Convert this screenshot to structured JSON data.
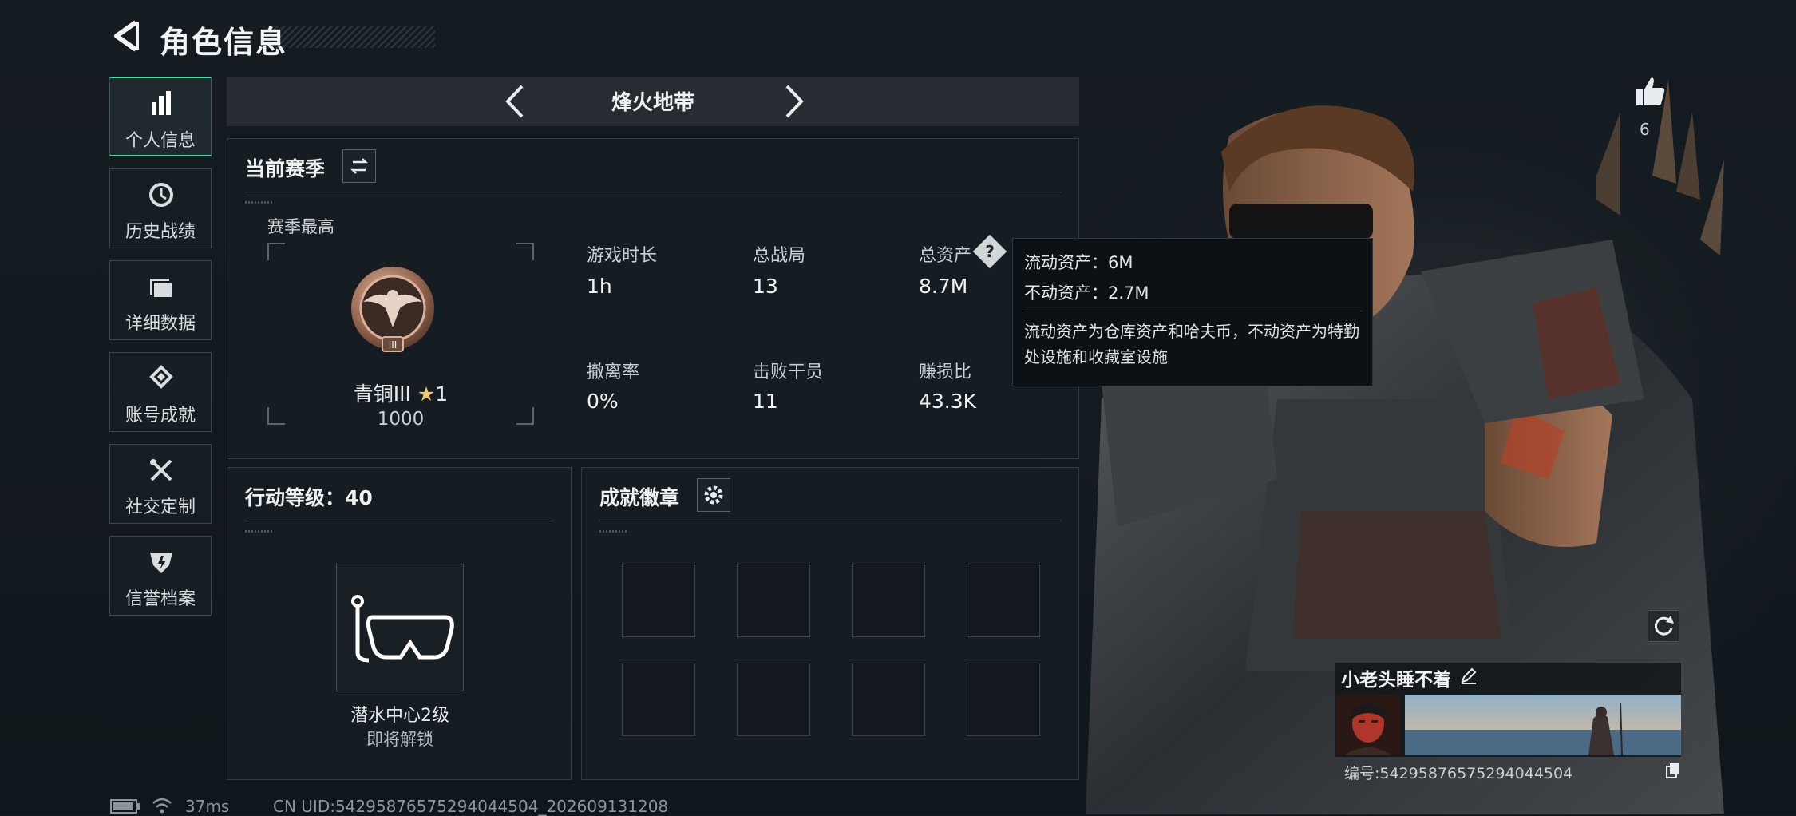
{
  "header": {
    "title": "角色信息",
    "back_icon": "back-arrow-icon"
  },
  "sidebar": {
    "items": [
      {
        "label": "个人信息",
        "icon": "bar-chart-icon",
        "active": true
      },
      {
        "label": "历史战绩",
        "icon": "history-clock-icon",
        "active": false
      },
      {
        "label": "详细数据",
        "icon": "folder-icon",
        "active": false
      },
      {
        "label": "账号成就",
        "icon": "achievement-icon",
        "active": false
      },
      {
        "label": "社交定制",
        "icon": "tools-icon",
        "active": false
      },
      {
        "label": "信誉档案",
        "icon": "shield-badge-icon",
        "active": false
      }
    ]
  },
  "mode_selector": {
    "name": "烽火地带"
  },
  "season": {
    "title": "当前赛季",
    "best_label": "赛季最高",
    "rank_name": "青铜III",
    "rank_stars": "1",
    "rank_points": "1000",
    "stats": [
      {
        "label": "游戏时长",
        "value": "1h"
      },
      {
        "label": "总战局",
        "value": "13"
      },
      {
        "label": "总资产",
        "value": "8.7M",
        "help": true
      },
      {
        "label": "撤离率",
        "value": "0%"
      },
      {
        "label": "击败干员",
        "value": "11"
      },
      {
        "label": "赚损比",
        "value": "43.3K"
      }
    ]
  },
  "tooltip": {
    "liquid": "流动资产：6M",
    "fixed": "不动资产：2.7M",
    "description": "流动资产为仓库资产和哈夫币，不动资产为特勤处设施和收藏室设施"
  },
  "action_level": {
    "title": "行动等级：40",
    "unlock_name": "潜水中心2级",
    "unlock_status": "即将解锁"
  },
  "badges": {
    "title": "成就徽章",
    "slots": 8
  },
  "profile": {
    "likes": "6",
    "nickname": "小老头睡不着",
    "id_label": "编号:542958765752940445​04"
  },
  "status_bar": {
    "ping": "37ms",
    "uid": "CN UID:542958765752940445​04_202609131208"
  },
  "colors": {
    "accent": "#3ee8a0",
    "panel_bg": "#161d23",
    "border": "#323a40"
  }
}
